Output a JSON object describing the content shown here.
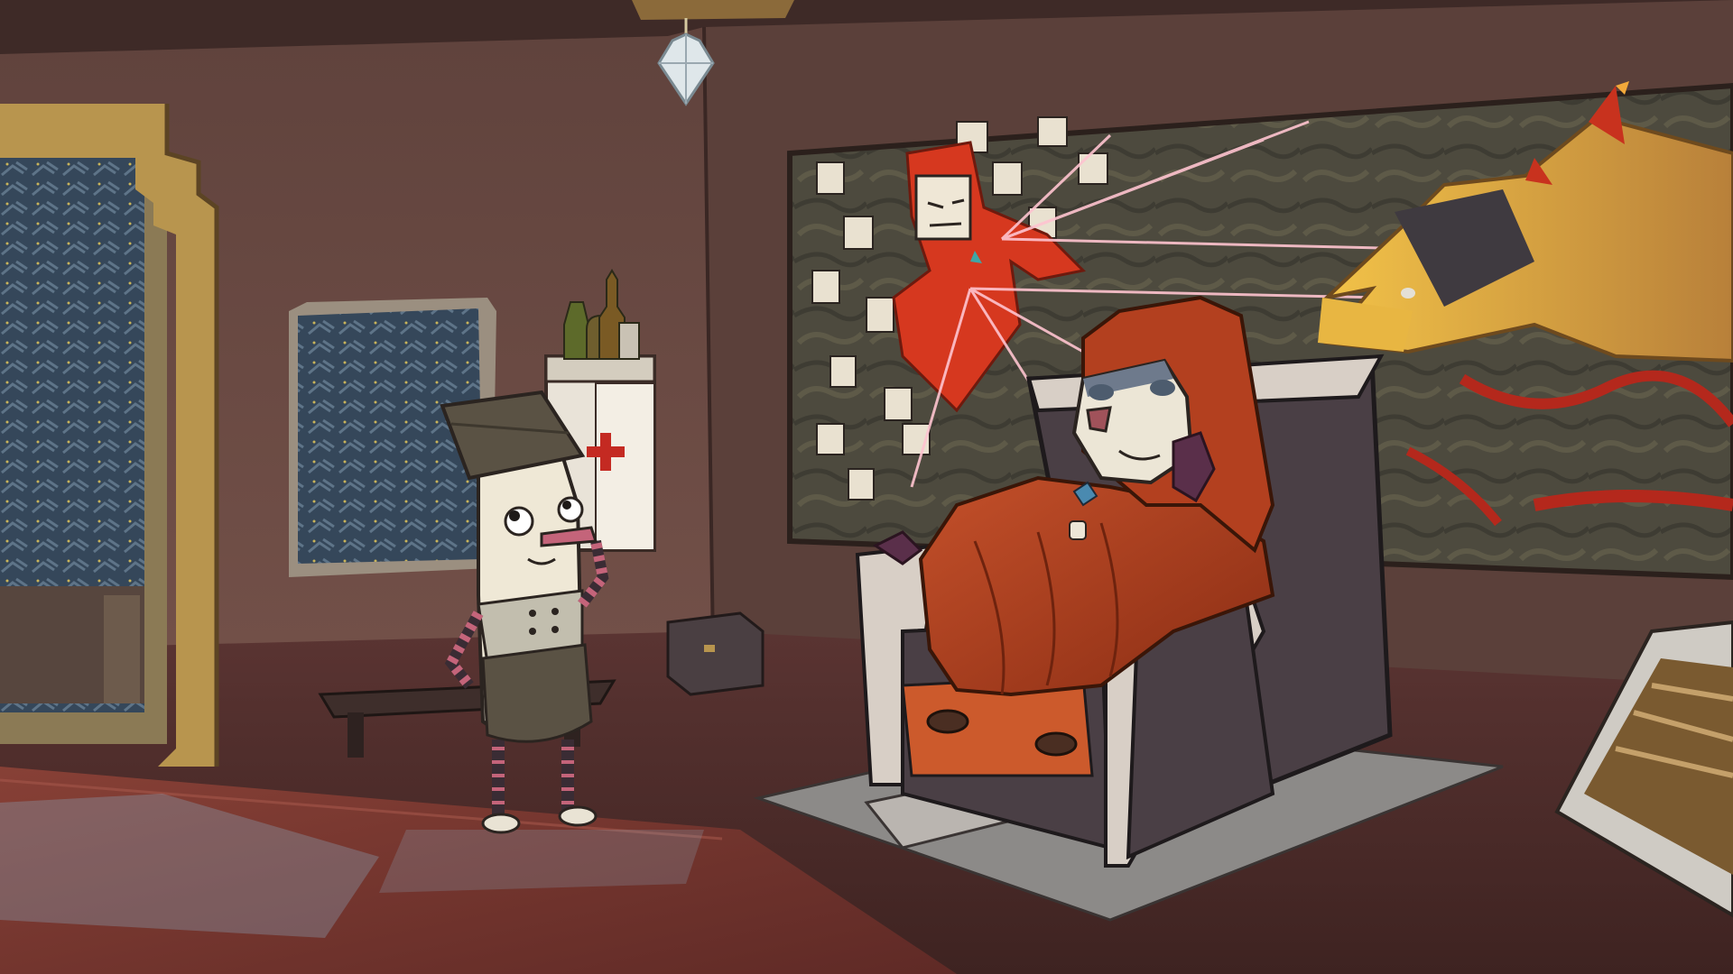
{
  "game": {
    "screen": "gameplay-scene",
    "setting": "throne-room-interior",
    "hud_visible": false,
    "dialogue_text": "",
    "cursor_visible": false
  },
  "palette": {
    "wall": "#6e4c44",
    "wall_dark": "#4c3430",
    "floor": "#5a2e2c",
    "rug": "#7a3532",
    "robe": "#b3401f",
    "robe_dark": "#8a2d14",
    "throne": "#4a3f45",
    "throne_light": "#d8cfc6",
    "skin": "#efe8d6",
    "hat": "#5a5244",
    "gold": "#b8954e",
    "red_cross": "#c42a22",
    "laser": "#ffb6c4",
    "window": "#3b4d5c"
  },
  "characters": [
    {
      "id": "small-hero",
      "name_shown": "",
      "pose": "thinking"
    },
    {
      "id": "hooded-king",
      "name_shown": "",
      "pose": "lounging-on-throne"
    }
  ],
  "objects": [
    {
      "id": "first-aid-cabinet",
      "icon": "red-cross-icon"
    },
    {
      "id": "bottles",
      "count": 3
    },
    {
      "id": "small-chest"
    },
    {
      "id": "wooden-bench"
    },
    {
      "id": "hanging-crystal-lamp"
    },
    {
      "id": "mural-red-giant"
    },
    {
      "id": "mural-dragon-head"
    },
    {
      "id": "throne"
    },
    {
      "id": "wooden-crate"
    },
    {
      "id": "doorway-left"
    },
    {
      "id": "wall-window"
    }
  ]
}
